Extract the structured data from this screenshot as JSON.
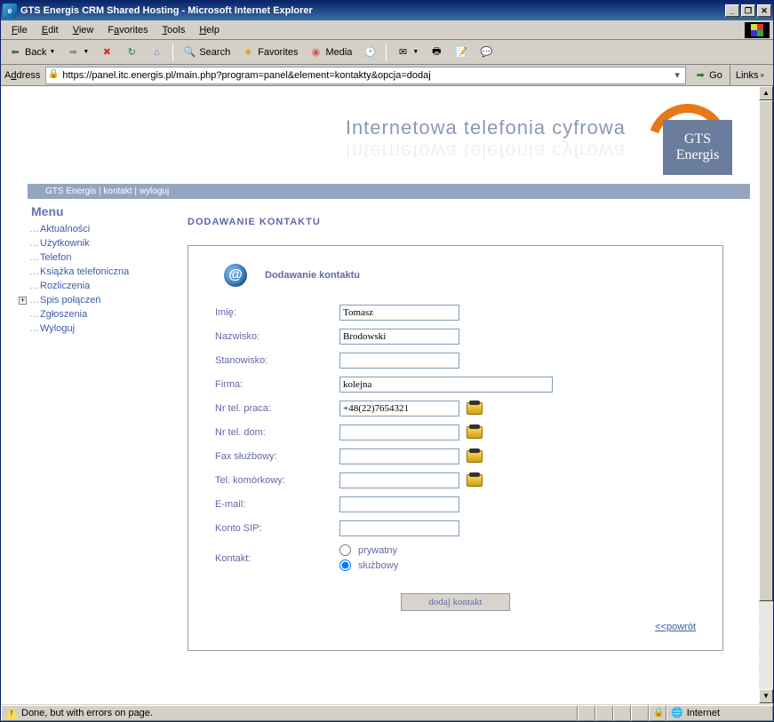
{
  "window": {
    "title": "GTS Energis CRM Shared Hosting - Microsoft Internet Explorer"
  },
  "menubar": {
    "file": "File",
    "edit": "Edit",
    "view": "View",
    "favorites": "Favorites",
    "tools": "Tools",
    "help": "Help"
  },
  "toolbar": {
    "back": "Back",
    "search": "Search",
    "favorites": "Favorites",
    "media": "Media"
  },
  "addressbar": {
    "label": "Address",
    "url": "https://panel.itc.energis.pl/main.php?program=panel&element=kontakty&opcja=dodaj",
    "go": "Go",
    "links": "Links"
  },
  "header": {
    "slogan": "Internetowa telefonia cyfrowa",
    "logo_line1": "GTS",
    "logo_line2": "Energis"
  },
  "navbar": {
    "brand": "GTS Energis",
    "contact": "kontakt",
    "logout": "wyloguj"
  },
  "sidebar": {
    "title": "Menu",
    "items": [
      {
        "label": "Aktualności"
      },
      {
        "label": "Użytkownik"
      },
      {
        "label": "Telefon"
      },
      {
        "label": "Książka telefoniczna"
      },
      {
        "label": "Rozliczenia"
      },
      {
        "label": "Spis połączeń",
        "expandable": true
      },
      {
        "label": "Zgłoszenia"
      },
      {
        "label": "Wyloguj"
      }
    ]
  },
  "main": {
    "page_title": "DODAWANIE KONTAKTU",
    "panel_title": "Dodawanie kontaktu",
    "labels": {
      "imie": "Imię:",
      "nazwisko": "Nazwisko:",
      "stanowisko": "Stanowisko:",
      "firma": "Firma:",
      "tel_praca": "Nr tel. praca:",
      "tel_dom": "Nr tel. dom:",
      "fax": "Fax służbowy:",
      "komorka": "Tel. komórkowy:",
      "email": "E-mail:",
      "sip": "Konto SIP:",
      "kontakt": "Kontakt:"
    },
    "values": {
      "imie": "Tomasz",
      "nazwisko": "Brodowski",
      "stanowisko": "",
      "firma": "kolejna",
      "tel_praca": "+48(22)7654321",
      "tel_dom": "",
      "fax": "",
      "komorka": "",
      "email": "",
      "sip": ""
    },
    "radio": {
      "prywatny": "prywatny",
      "sluzbowy": "służbowy",
      "selected": "sluzbowy"
    },
    "submit": "dodaj kontakt",
    "back": "<<powrót"
  },
  "statusbar": {
    "text": "Done, but with errors on page.",
    "zone": "Internet"
  }
}
